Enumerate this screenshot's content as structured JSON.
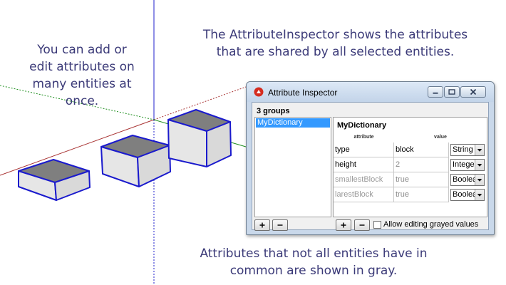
{
  "annotations": {
    "left": [
      "You can add or",
      "edit attributes on",
      "many entities at",
      "once."
    ],
    "top": [
      "The AttributeInspector shows the attributes",
      "that are shared by all selected entities."
    ],
    "bottom": [
      "Attributes that not all entities have in",
      "common are shown in gray."
    ]
  },
  "dialog": {
    "title": "Attribute Inspector",
    "groups_label": "3 groups",
    "dictionaries": [
      "MyDictionary"
    ],
    "selected_dictionary": "MyDictionary",
    "columns": {
      "attribute": "attribute",
      "value": "value"
    },
    "rows": [
      {
        "name": "type",
        "value": "block",
        "type": "String",
        "shared": true
      },
      {
        "name": "height",
        "value": "2",
        "type": "Integer",
        "shared": true
      },
      {
        "name": "smallestBlock",
        "value": "true",
        "type": "Boolean",
        "shared": false
      },
      {
        "name": "larestBlock",
        "value": "true",
        "type": "Boolean",
        "shared": false
      }
    ],
    "add_label": "+",
    "remove_label": "−",
    "allow_grayed_label": "Allow editing grayed values",
    "allow_grayed_checked": false
  },
  "colors": {
    "annotation_text": "#3b3a78",
    "block_edge": "#1a1acd",
    "block_top": "#7f7f7f",
    "block_side": "#e2e2e2",
    "axis_blue": "#2222cc",
    "axis_red": "#a83232",
    "axis_green": "#1f8f1f",
    "selection": "#3399ff"
  },
  "icons": {
    "app": "sketchup-logo-icon",
    "minimize": "minimize-icon",
    "maximize": "maximize-icon",
    "close": "close-icon",
    "dropdown": "chevron-down-icon"
  }
}
